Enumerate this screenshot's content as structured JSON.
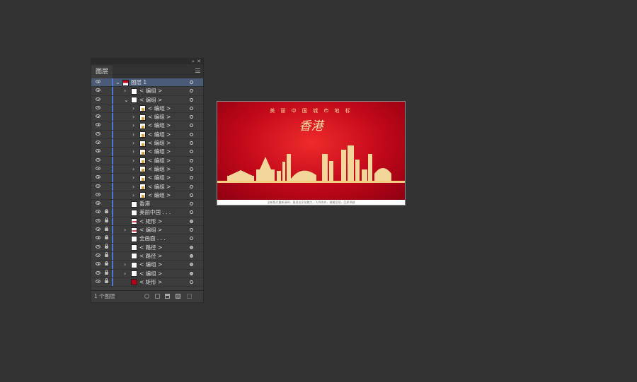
{
  "panel": {
    "tab_label": "图层",
    "footer_text": "1 个图层",
    "rows": [
      {
        "label": "图层 1",
        "tw": "v",
        "thumb": "red",
        "lock": false,
        "indent": 0,
        "selected": true,
        "target": "ring"
      },
      {
        "label": "< 编组 >",
        "tw": ">",
        "thumb": "white",
        "lock": false,
        "indent": 1,
        "target": "ring"
      },
      {
        "label": "< 编组 >",
        "tw": "v",
        "thumb": "white",
        "lock": false,
        "indent": 1,
        "target": "ring"
      },
      {
        "label": "< 编组 >",
        "tw": ">",
        "thumb": "gold",
        "lock": false,
        "indent": 2,
        "target": "ring"
      },
      {
        "label": "< 编组 >",
        "tw": ">",
        "thumb": "gold",
        "lock": false,
        "indent": 2,
        "target": "ring"
      },
      {
        "label": "< 编组 >",
        "tw": ">",
        "thumb": "gold",
        "lock": false,
        "indent": 2,
        "target": "ring"
      },
      {
        "label": "< 编组 >",
        "tw": ">",
        "thumb": "gold",
        "lock": false,
        "indent": 2,
        "target": "ring"
      },
      {
        "label": "< 编组 >",
        "tw": ">",
        "thumb": "gold",
        "lock": false,
        "indent": 2,
        "target": "ring"
      },
      {
        "label": "< 编组 >",
        "tw": ">",
        "thumb": "gold",
        "lock": false,
        "indent": 2,
        "target": "ring"
      },
      {
        "label": "< 编组 >",
        "tw": ">",
        "thumb": "gold",
        "lock": false,
        "indent": 2,
        "target": "ring"
      },
      {
        "label": "< 编组 >",
        "tw": ">",
        "thumb": "gold",
        "lock": false,
        "indent": 2,
        "target": "ring"
      },
      {
        "label": "< 编组 >",
        "tw": ">",
        "thumb": "gold",
        "lock": false,
        "indent": 2,
        "target": "ring"
      },
      {
        "label": "< 编组 >",
        "tw": ">",
        "thumb": "gold",
        "lock": false,
        "indent": 2,
        "target": "ring"
      },
      {
        "label": "< 编组 >",
        "tw": ">",
        "thumb": "gold",
        "lock": false,
        "indent": 2,
        "target": "ring"
      },
      {
        "label": "香港",
        "tw": "",
        "thumb": "white",
        "lock": false,
        "indent": 1,
        "target": "ring"
      },
      {
        "label": "美丽中国 . . .",
        "tw": "",
        "thumb": "white",
        "lock": true,
        "indent": 1,
        "target": "ring"
      },
      {
        "label": "< 矩形 >",
        "tw": "",
        "thumb": "pink",
        "lock": true,
        "indent": 1,
        "target": "filled"
      },
      {
        "label": "< 编组 >",
        "tw": ">",
        "thumb": "pink",
        "lock": true,
        "indent": 1,
        "target": "ring"
      },
      {
        "label": "全画面 . . .",
        "tw": "",
        "thumb": "white",
        "lock": true,
        "indent": 1,
        "target": "ring"
      },
      {
        "label": "< 路径 >",
        "tw": "",
        "thumb": "white",
        "lock": true,
        "indent": 1,
        "target": "filled"
      },
      {
        "label": "< 路径 >",
        "tw": "",
        "thumb": "white",
        "lock": true,
        "indent": 1,
        "target": "filled"
      },
      {
        "label": "< 编组 >",
        "tw": ">",
        "thumb": "white",
        "lock": true,
        "indent": 1,
        "target": "filled"
      },
      {
        "label": "< 编组 >",
        "tw": ">",
        "thumb": "white",
        "lock": true,
        "indent": 1,
        "target": "filled"
      },
      {
        "label": "< 矩形 >",
        "tw": "",
        "thumb": "redflat",
        "lock": true,
        "indent": 1,
        "target": "ring"
      }
    ]
  },
  "artboard": {
    "title": "美 丽 中 国   城 市 地 标",
    "city": "香港",
    "footer": "全新版式重新演绎，展现出文化魅力，大师杰作，精美呈现，品质卓越",
    "colors": {
      "red": "#c0081a",
      "gold": "#f3d69a"
    }
  }
}
